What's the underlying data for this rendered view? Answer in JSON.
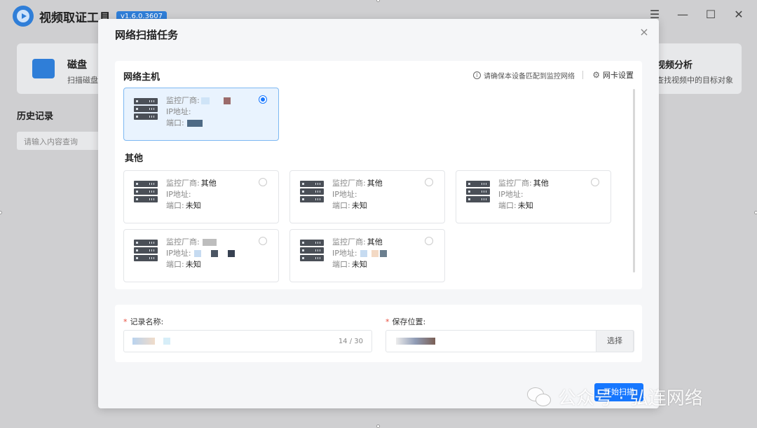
{
  "app": {
    "title": "视频取证工具",
    "version": "v1.6.0.3607"
  },
  "background": {
    "card_left": {
      "title": "磁盘",
      "subtitle": "扫描磁盘"
    },
    "card_right": {
      "title": "视频分析",
      "subtitle": "查找视频中的目标对象"
    },
    "history_title": "历史记录",
    "search_placeholder": "请输入内容查询"
  },
  "modal": {
    "title": "网络扫描任务",
    "close_icon": "×",
    "host_section": {
      "title": "网络主机",
      "hint": "请确保本设备匹配到监控网络",
      "nic_label": "网卡设置"
    },
    "other_section_title": "其他",
    "labels": {
      "vendor": "监控厂商:",
      "ip": "IP地址:",
      "port": "端口:"
    },
    "host_cards": [
      {
        "vendor": "",
        "ip": "",
        "port": "",
        "selected": true
      }
    ],
    "other_cards": [
      {
        "vendor": "其他",
        "ip": "",
        "port": "未知",
        "selected": false
      },
      {
        "vendor": "其他",
        "ip": "",
        "port": "未知",
        "selected": false
      },
      {
        "vendor": "其他",
        "ip": "",
        "port": "未知",
        "selected": false
      },
      {
        "vendor": "",
        "ip": "",
        "port": "未知",
        "selected": false
      },
      {
        "vendor": "其他",
        "ip": "",
        "port": "未知",
        "selected": false
      }
    ],
    "form": {
      "record_name_label": "记录名称:",
      "record_name_counter": "14 / 30",
      "save_location_label": "保存位置:",
      "choose_button": "选择"
    },
    "start_button": "开始扫描"
  },
  "watermark": "公众号 · 弘连网络",
  "colors": {
    "primary": "#1677ff",
    "selected_bg": "#e9f3fe",
    "overlay": "#cfcfd1"
  }
}
